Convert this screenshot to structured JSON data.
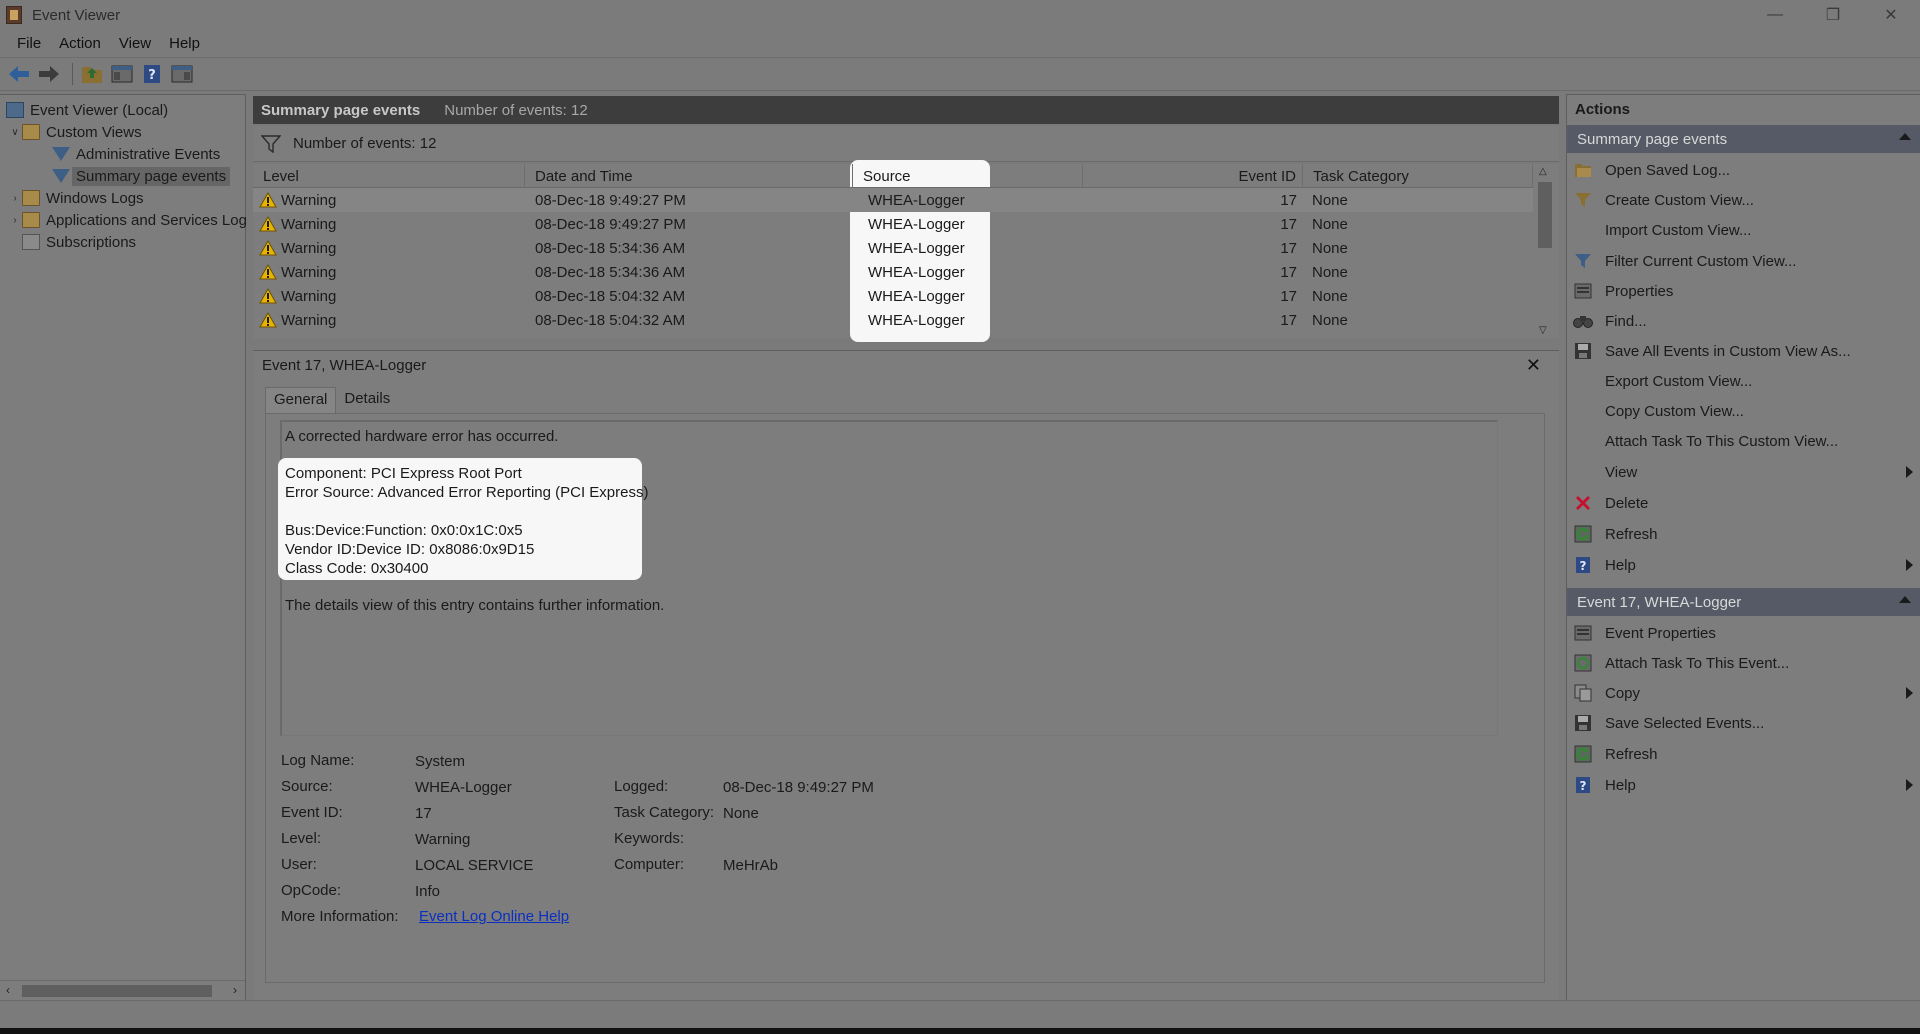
{
  "window": {
    "title": "Event Viewer",
    "controls": [
      "—",
      "❐",
      "✕"
    ]
  },
  "menu": [
    "File",
    "Action",
    "View",
    "Help"
  ],
  "tree": {
    "root": "Event Viewer (Local)",
    "custom_views": "Custom Views",
    "admin_events": "Administrative Events",
    "summary_events": "Summary page events",
    "windows_logs": "Windows Logs",
    "apps_services": "Applications and Services Log",
    "subscriptions": "Subscriptions"
  },
  "center": {
    "title": "Summary page events",
    "count_header": "Number of events: 12",
    "filter_count": "Number of events: 12"
  },
  "table": {
    "columns": [
      "Level",
      "Date and Time",
      "Source",
      "Event ID",
      "Task Category"
    ],
    "rows": [
      {
        "level": "Warning",
        "date": "08-Dec-18 9:49:27 PM",
        "source": "WHEA-Logger",
        "event_id": "17",
        "task": "None"
      },
      {
        "level": "Warning",
        "date": "08-Dec-18 9:49:27 PM",
        "source": "WHEA-Logger",
        "event_id": "17",
        "task": "None"
      },
      {
        "level": "Warning",
        "date": "08-Dec-18 5:34:36 AM",
        "source": "WHEA-Logger",
        "event_id": "17",
        "task": "None"
      },
      {
        "level": "Warning",
        "date": "08-Dec-18 5:34:36 AM",
        "source": "WHEA-Logger",
        "event_id": "17",
        "task": "None"
      },
      {
        "level": "Warning",
        "date": "08-Dec-18 5:04:32 AM",
        "source": "WHEA-Logger",
        "event_id": "17",
        "task": "None"
      },
      {
        "level": "Warning",
        "date": "08-Dec-18 5:04:32 AM",
        "source": "WHEA-Logger",
        "event_id": "17",
        "task": "None"
      }
    ]
  },
  "detail": {
    "header": "Event 17, WHEA-Logger",
    "tabs": [
      "General",
      "Details"
    ],
    "description": [
      "A corrected hardware error has occurred.",
      "Component: PCI Express Root Port",
      "Error Source: Advanced Error Reporting (PCI Express)",
      "Bus:Device:Function: 0x0:0x1C:0x5",
      "Vendor ID:Device ID: 0x8086:0x9D15",
      "Class Code: 0x30400",
      "The details view of this entry contains further information."
    ],
    "props": {
      "log_name_label": "Log Name:",
      "log_name": "System",
      "source_label": "Source:",
      "source": "WHEA-Logger",
      "logged_label": "Logged:",
      "logged": "08-Dec-18 9:49:27 PM",
      "event_id_label": "Event ID:",
      "event_id": "17",
      "task_category_label": "Task Category:",
      "task_category": "None",
      "level_label": "Level:",
      "level": "Warning",
      "keywords_label": "Keywords:",
      "keywords": "",
      "user_label": "User:",
      "user": "LOCAL SERVICE",
      "computer_label": "Computer:",
      "computer": "MeHrAb",
      "opcode_label": "OpCode:",
      "opcode": "Info",
      "more_info_label": "More Information:",
      "more_info_link": "Event Log Online Help"
    }
  },
  "actions": {
    "title": "Actions",
    "section1": "Summary page events",
    "items1": [
      "Open Saved Log...",
      "Create Custom View...",
      "Import Custom View...",
      "Filter Current Custom View...",
      "Properties",
      "Find...",
      "Save All Events in Custom View As...",
      "Export Custom View...",
      "Copy Custom View...",
      "Attach Task To This Custom View...",
      "View",
      "Delete",
      "Refresh",
      "Help"
    ],
    "section2": "Event 17, WHEA-Logger",
    "items2": [
      "Event Properties",
      "Attach Task To This Event...",
      "Copy",
      "Save Selected Events...",
      "Refresh",
      "Help"
    ]
  },
  "colors": {
    "highlight": "#f7f7f7",
    "section_header": "#555a66",
    "link": "#0b2fbf",
    "warning": "#e8b400",
    "delete": "#c8102e"
  }
}
